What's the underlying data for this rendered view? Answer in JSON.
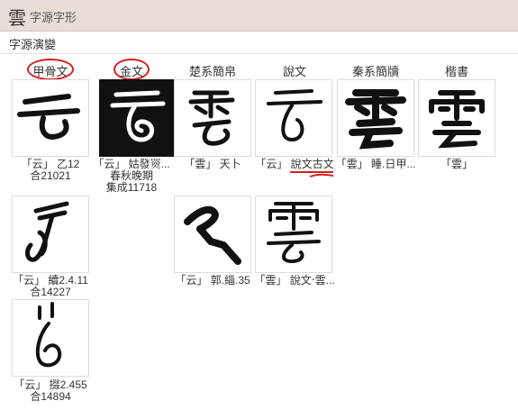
{
  "header": {
    "char": "雲",
    "title": "字源字形"
  },
  "section_title": "字源演變",
  "columns": [
    "甲骨文",
    "金文",
    "楚系簡帛",
    "說文",
    "秦系簡牘",
    "楷書"
  ],
  "glyphs": [
    {
      "id": "jgw-1",
      "cap1": "「云」 乙12",
      "cap2": "合21021",
      "cap3": ""
    },
    {
      "id": "jw-1",
      "cap1": "「云」 姑發𦌚...",
      "cap2": "春秋晚期",
      "cap3": "集成11718"
    },
    {
      "id": "chu-1",
      "cap1": "「雲」 天卜",
      "cap2": "",
      "cap3": ""
    },
    {
      "id": "sw-1",
      "cap1": "「云」",
      "cap_link": "說文古文",
      "cap2": "",
      "cap3": ""
    },
    {
      "id": "qin-1",
      "cap1": "「雲」 睡.日甲...",
      "cap2": "",
      "cap3": ""
    },
    {
      "id": "kai-1",
      "cap1": "「雲」",
      "cap2": "",
      "cap3": ""
    },
    {
      "id": "jgw-2",
      "cap1": "「云」 續2.4.11",
      "cap2": "合14227",
      "cap3": ""
    },
    {
      "id": "chu-2",
      "cap1": "「云」 郭.緇.35",
      "cap2": "",
      "cap3": ""
    },
    {
      "id": "sw-2",
      "cap1": "「雲」 說文‧雲...",
      "cap2": "",
      "cap3": ""
    },
    {
      "id": "jgw-3",
      "cap1": "「云」 掇2.455",
      "cap2": "合14894",
      "cap3": ""
    }
  ],
  "colors": {
    "header_bg": "#e8ddd6",
    "annotation": "#d32020",
    "ink": "#111111"
  }
}
